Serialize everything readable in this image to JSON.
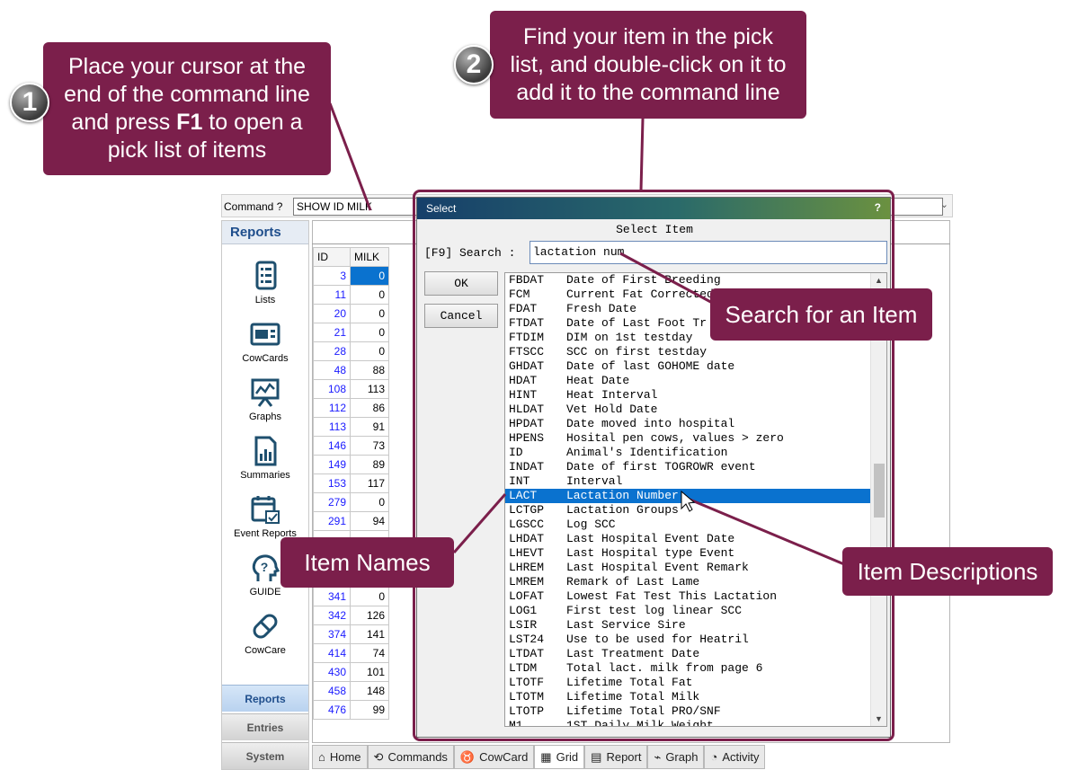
{
  "callouts": {
    "step1": {
      "num": "1",
      "line1": "Place your cursor at the",
      "line2": "end of the command line",
      "line3_pre": "and press ",
      "line3_key": "F1",
      "line3_post": " to open a",
      "line4": "pick list of items"
    },
    "step2": {
      "num": "2",
      "line1": "Find your item in the pick",
      "line2": "list, and double-click on it to",
      "line3": "add it to the command line"
    },
    "search": "Search for an Item",
    "names": "Item Names",
    "descriptions": "Item Descriptions"
  },
  "command": {
    "label": "Command ?",
    "value": "SHOW ID MILK"
  },
  "sidebar": {
    "header": "Reports",
    "items": [
      {
        "label": "Lists",
        "icon": "list-icon"
      },
      {
        "label": "CowCards",
        "icon": "cowcard-icon"
      },
      {
        "label": "Graphs",
        "icon": "graph-icon"
      },
      {
        "label": "Summaries",
        "icon": "summary-icon"
      },
      {
        "label": "Event Reports",
        "icon": "calendar-icon"
      },
      {
        "label": "GUIDE",
        "icon": "guide-icon"
      },
      {
        "label": "CowCare",
        "icon": "pill-icon"
      }
    ],
    "buttons": [
      "Reports",
      "Entries",
      "System"
    ]
  },
  "grid": {
    "headers": [
      "ID",
      "MILK"
    ],
    "rows": [
      [
        "3",
        "0"
      ],
      [
        "11",
        "0"
      ],
      [
        "20",
        "0"
      ],
      [
        "21",
        "0"
      ],
      [
        "28",
        "0"
      ],
      [
        "48",
        "88"
      ],
      [
        "108",
        "113"
      ],
      [
        "112",
        "86"
      ],
      [
        "113",
        "91"
      ],
      [
        "146",
        "73"
      ],
      [
        "149",
        "89"
      ],
      [
        "153",
        "117"
      ],
      [
        "279",
        "0"
      ],
      [
        "291",
        "94"
      ],
      [
        "",
        "",
        ""
      ],
      [
        "",
        "",
        ""
      ],
      [
        "",
        "",
        ""
      ],
      [
        "341",
        "0"
      ],
      [
        "342",
        "126"
      ],
      [
        "374",
        "141"
      ],
      [
        "414",
        "74"
      ],
      [
        "430",
        "101"
      ],
      [
        "458",
        "148"
      ],
      [
        "476",
        "99"
      ]
    ]
  },
  "tabs": [
    {
      "label": "Home",
      "icon": "home-icon"
    },
    {
      "label": "Commands",
      "icon": "commands-icon"
    },
    {
      "label": "CowCard",
      "icon": "cow-icon"
    },
    {
      "label": "Grid",
      "icon": "grid-icon"
    },
    {
      "label": "Report",
      "icon": "report-icon"
    },
    {
      "label": "Graph",
      "icon": "graph-tab-icon"
    },
    {
      "label": "Activity",
      "icon": "activity-icon"
    }
  ],
  "dialog": {
    "title": "Select",
    "help": "?",
    "heading": "Select Item",
    "search_label": "[F9] Search :",
    "search_value": "lactation num",
    "ok": "OK",
    "cancel": "Cancel",
    "selected_index": 15,
    "items": [
      [
        "FBDAT",
        "Date of First Breeding"
      ],
      [
        "FCM",
        "Current Fat Corrected"
      ],
      [
        "FDAT",
        "Fresh Date"
      ],
      [
        "FTDAT",
        "Date of Last Foot Tr"
      ],
      [
        "FTDIM",
        "DIM on 1st testday"
      ],
      [
        "FTSCC",
        "SCC on first testday"
      ],
      [
        "GHDAT",
        "Date of last GOHOME date"
      ],
      [
        "HDAT",
        "Heat Date"
      ],
      [
        "HINT",
        "Heat Interval"
      ],
      [
        "HLDAT",
        "Vet Hold Date"
      ],
      [
        "HPDAT",
        "Date moved into hospital"
      ],
      [
        "HPENS",
        "Hosital pen cows, values > zero"
      ],
      [
        "ID",
        "Animal's Identification"
      ],
      [
        "INDAT",
        "Date of first TOGROWR event"
      ],
      [
        "INT",
        "Interval"
      ],
      [
        "LACT",
        "Lactation Number"
      ],
      [
        "LCTGP",
        "Lactation Groups"
      ],
      [
        "LGSCC",
        "Log SCC"
      ],
      [
        "LHDAT",
        "Last Hospital Event Date"
      ],
      [
        "LHEVT",
        "Last Hospital type Event"
      ],
      [
        "LHREM",
        "Last Hospital Event Remark"
      ],
      [
        "LMREM",
        "Remark of Last Lame"
      ],
      [
        "LOFAT",
        "Lowest Fat Test This Lactation"
      ],
      [
        "LOG1",
        "First test log linear SCC"
      ],
      [
        "LSIR",
        "Last Service Sire"
      ],
      [
        "LST24",
        "Use to be used for Heatril"
      ],
      [
        "LTDAT",
        "Last Treatment Date"
      ],
      [
        "LTDM",
        "Total lact. milk from page 6"
      ],
      [
        "LTOTF",
        "Lifetime Total Fat"
      ],
      [
        "LTOTM",
        "Lifetime Total Milk"
      ],
      [
        "LTOTP",
        "Lifetime Total PRO/SNF"
      ],
      [
        "M1",
        "1ST Daily Milk Weight"
      ]
    ]
  }
}
